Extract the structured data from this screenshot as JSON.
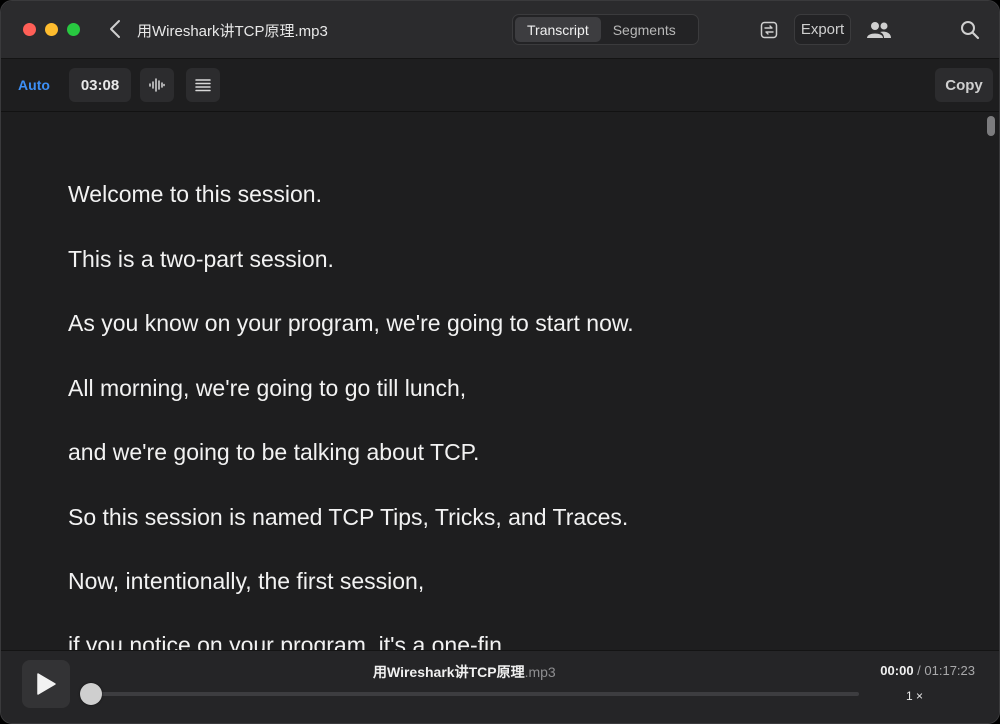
{
  "window": {
    "title": "用Wireshark讲TCP原理.mp3",
    "tabs": [
      {
        "label": "Transcript",
        "active": true
      },
      {
        "label": "Segments",
        "active": false
      }
    ],
    "export_label": "Export"
  },
  "toolbar": {
    "auto_label": "Auto",
    "time_label": "03:08",
    "copy_label": "Copy"
  },
  "transcript": {
    "lines": [
      "Welcome to this session.",
      "This is a two-part session.",
      "As you know on your program, we're going to start now.",
      "All morning, we're going to go till lunch,",
      "and we're going to be talking about TCP.",
      "So this session is named TCP Tips, Tricks, and Traces.",
      "Now, intentionally, the first session,",
      "if you notice on your program, it's a one-fin"
    ]
  },
  "player": {
    "track_name": "用Wireshark讲TCP原理",
    "track_ext": ".mp3",
    "current_time": "00:00",
    "separator": " / ",
    "total_time": "01:17:23",
    "progress": 0,
    "speed": "1 ×"
  },
  "colors": {
    "accent": "#3d8ff5",
    "background": "#1e1e1f",
    "titlebar": "#2b2b2d"
  },
  "icons": [
    "back-chevron-icon",
    "sync-icon",
    "people-icon",
    "search-icon",
    "waveform-icon",
    "list-icon",
    "play-icon"
  ]
}
